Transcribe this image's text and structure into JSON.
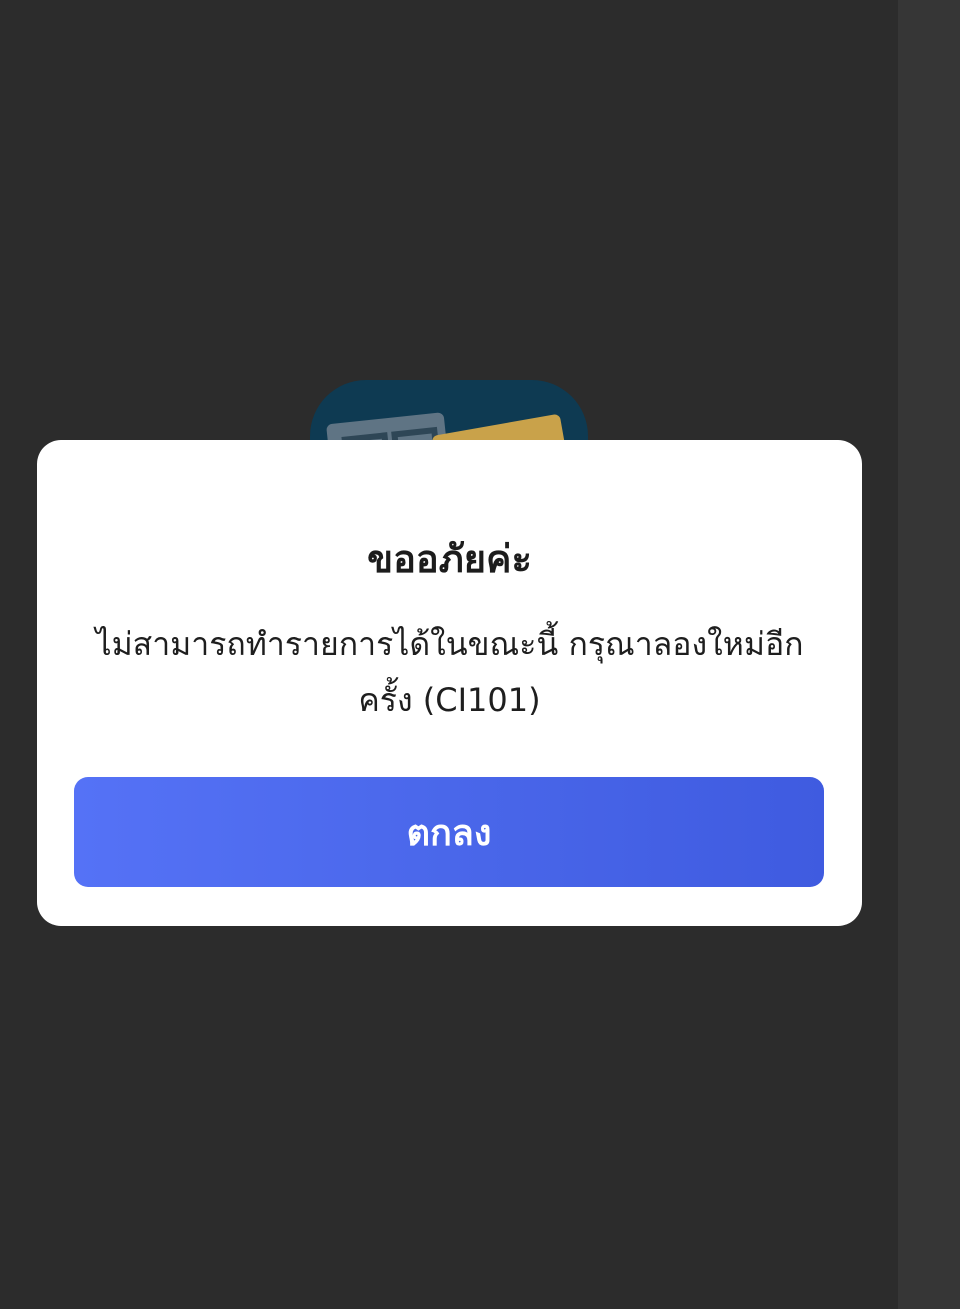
{
  "dialog": {
    "title": "ขออภัยค่ะ",
    "message": "ไม่สามารถทำรายการได้ในขณะนี้ กรุณาลองใหม่อีกครั้ง (CI101)",
    "ok_label": "ตกลง"
  },
  "icons": {
    "app_icon": "app-icon"
  },
  "colors": {
    "background": "#2c2c2c",
    "dialog_bg": "#ffffff",
    "button_accent": "#4a67ea",
    "button_text": "#ffffff"
  }
}
